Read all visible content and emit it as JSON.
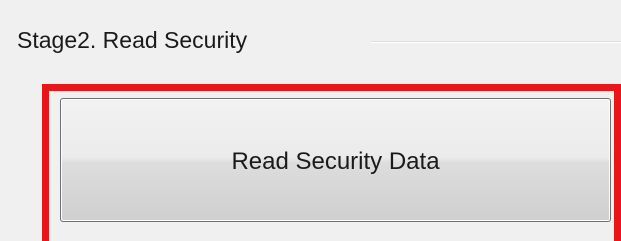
{
  "group": {
    "title": "Stage2. Read Security"
  },
  "actions": {
    "read_security_label": "Read Security Data"
  },
  "colors": {
    "highlight": "#e8161b",
    "window_bg": "#f0f0f0"
  }
}
